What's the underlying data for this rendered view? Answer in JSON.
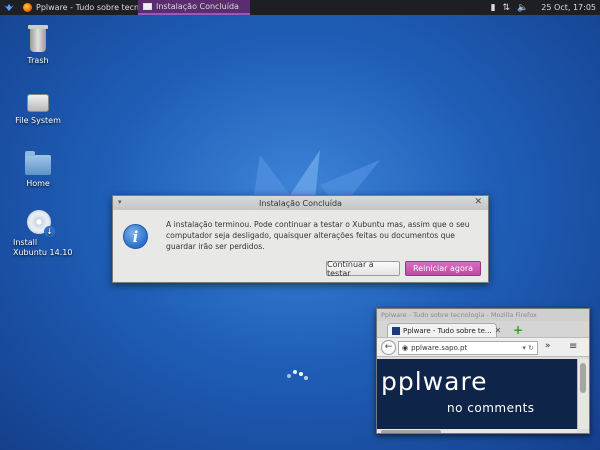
{
  "panel": {
    "tasks": [
      {
        "label": "Pplware - Tudo sobre tecn..."
      },
      {
        "label": "Instalação Concluída"
      }
    ],
    "clock": "25 Oct, 17:05"
  },
  "desktop_icons": [
    {
      "label": "Trash"
    },
    {
      "label": "File System"
    },
    {
      "label": "Home"
    },
    {
      "label_line1": "Install",
      "label_line2": "Xubuntu 14.10"
    }
  ],
  "dialog": {
    "title": "Instalação Concluída",
    "message": "A instalação terminou. Pode continuar a testar o Xubuntu mas, assim que o seu computador seja desligado, quaisquer alterações feitas ou documentos que guardar irão ser perdidos.",
    "continue_label": "Continuar a testar",
    "restart_label": "Reiniciar agora",
    "accent_color": "#bd4aa3"
  },
  "firefox": {
    "window_title": "Pplware - Tudo sobre tecnologia - Mozilla Firefox",
    "tab_label": "Pplware - Tudo sobre te...",
    "url": "pplware.sapo.pt",
    "brand_text": "pplware",
    "tagline": "no comments"
  }
}
